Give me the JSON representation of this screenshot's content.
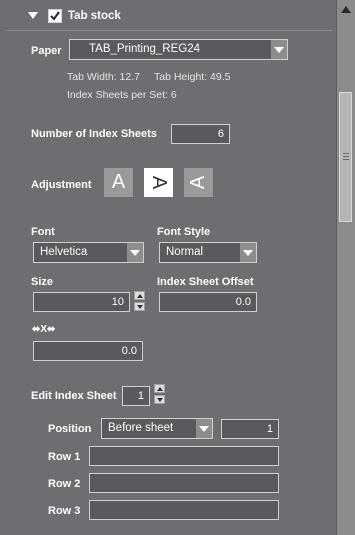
{
  "section": {
    "title": "Tab stock",
    "checked": true
  },
  "paper": {
    "label": "Paper",
    "value": "TAB_Printing_REG24",
    "tab_width": "Tab Width: 12.7",
    "tab_height": "Tab Height: 49.5",
    "index_sheets_per_set": "Index Sheets per Set: 6"
  },
  "num_index_sheets": {
    "label": "Number of Index Sheets",
    "value": "6"
  },
  "adjustment": {
    "label": "Adjustment",
    "glyph": "A",
    "selected_index": 1
  },
  "font": {
    "label": "Font",
    "value": "Helvetica"
  },
  "font_style": {
    "label": "Font Style",
    "value": "Normal"
  },
  "size": {
    "label": "Size",
    "value": "10"
  },
  "offset": {
    "label": "Index Sheet Offset",
    "value": "0.0"
  },
  "x_offset": {
    "label": "⬌X⬌",
    "value": "0.0"
  },
  "edit_sheet": {
    "label": "Edit Index Sheet",
    "value": "1"
  },
  "position": {
    "label": "Position",
    "value": "Before sheet",
    "number": "1"
  },
  "rows": [
    {
      "label": "Row 1",
      "value": ""
    },
    {
      "label": "Row 2",
      "value": ""
    },
    {
      "label": "Row 3",
      "value": ""
    }
  ],
  "colors": {
    "panel": "#6e6e72",
    "field": "#5a5a5e",
    "accent_selected": "#ffffff"
  },
  "icons": {
    "collapse": "triangle-down-icon",
    "check": "checkmark-icon",
    "x_offset": "horizontal-arrows-icon"
  }
}
